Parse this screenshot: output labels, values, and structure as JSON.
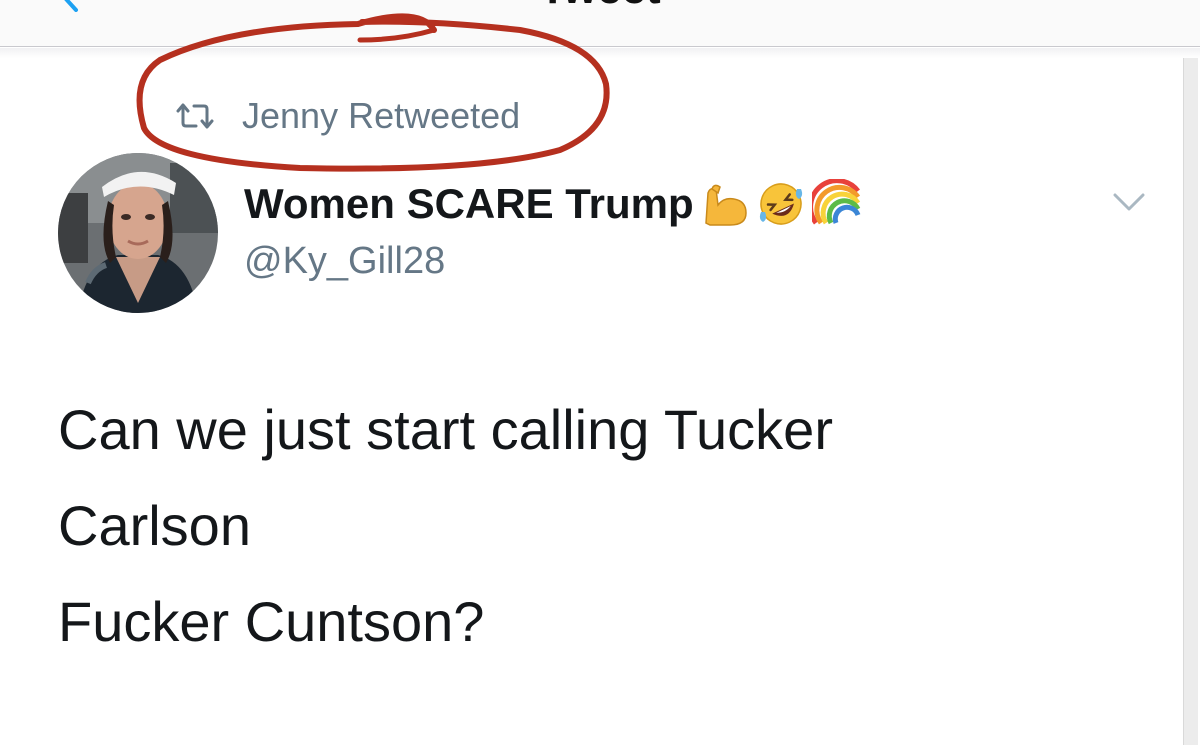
{
  "header": {
    "title": "Tweet"
  },
  "retweet": {
    "label": "Jenny Retweeted",
    "icon": "retweet-icon"
  },
  "author": {
    "name": "Women SCARE Trump",
    "handle": "@Ky_Gill28",
    "emojis": [
      "flexed-biceps-emoji",
      "rolling-laughing-emoji",
      "rainbow-emoji"
    ]
  },
  "tweet": {
    "lines": [
      "Can we just start calling Tucker",
      "Carlson",
      "Fucker Cuntson?"
    ]
  },
  "colors": {
    "text_primary": "#14171a",
    "text_secondary": "#657786",
    "annotation_red": "#b5301f",
    "divider": "#c9c9ce"
  }
}
